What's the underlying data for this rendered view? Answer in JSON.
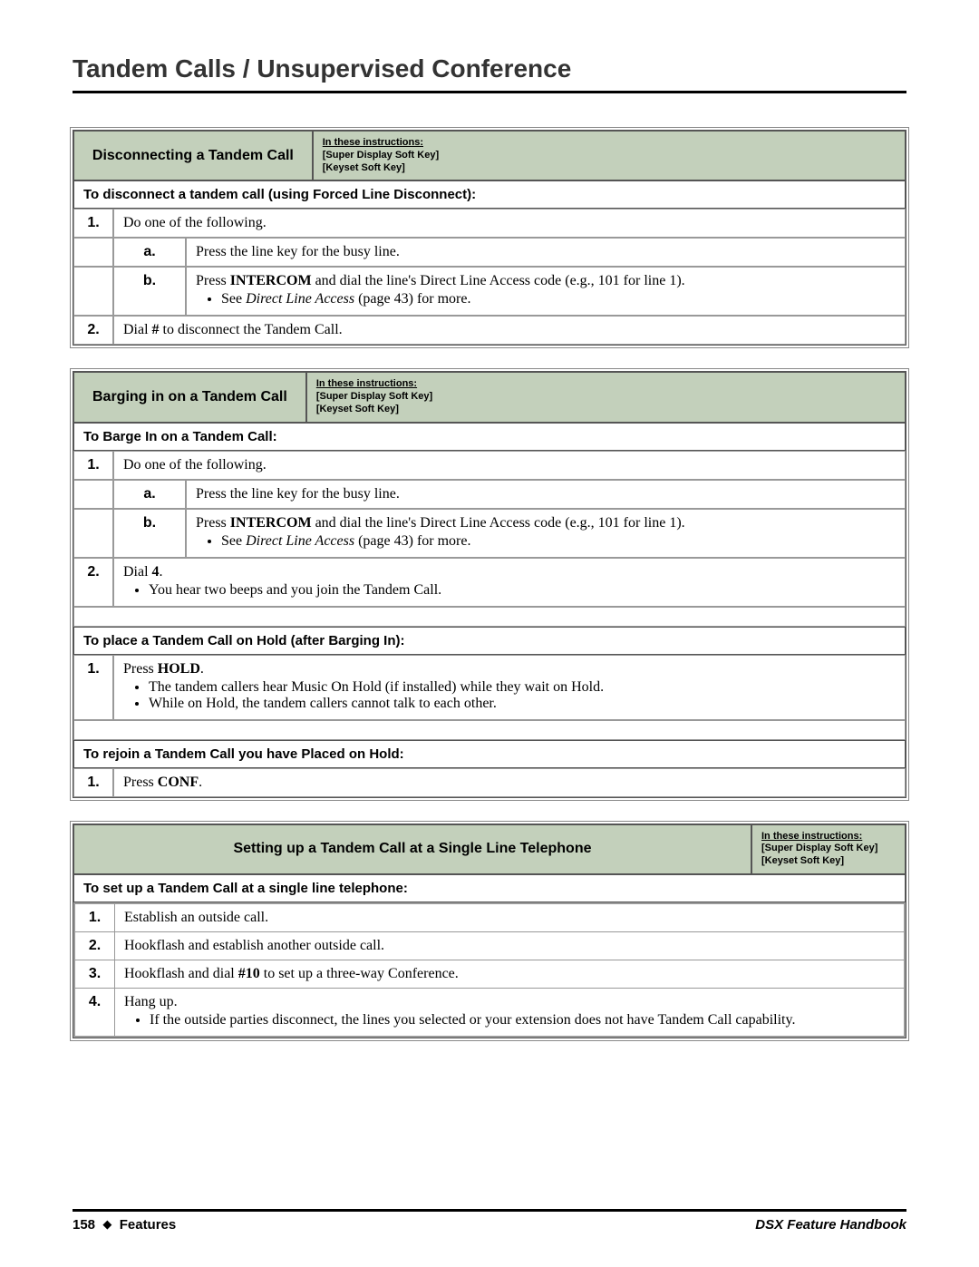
{
  "title": "Tandem Calls / Unsupervised Conference",
  "note": {
    "line1": "In these instructions:",
    "line2": "[Super Display Soft Key]",
    "line3": "[Keyset Soft Key]"
  },
  "table1": {
    "header": "Disconnecting a Tandem Call",
    "section1": "To disconnect a tandem call (using Forced Line Disconnect):",
    "step1_num": "1.",
    "step1": "Do one of the following.",
    "sub_a": "a.",
    "sub_a_text": "Press the line key for the busy line.",
    "sub_b": "b.",
    "sub_b_prefix": "Press ",
    "sub_b_bold": "INTERCOM",
    "sub_b_suffix": " and dial the line's Direct Line Access code (e.g., 101 for line 1).",
    "sub_b_bullet_pre": "See ",
    "sub_b_bullet_it": "Direct Line Access",
    "sub_b_bullet_post": " (page 43) for more.",
    "step2_num": "2.",
    "step2_pre": "Dial ",
    "step2_bold": "#",
    "step2_post": " to disconnect the Tandem Call."
  },
  "table2": {
    "header": "Barging in on a Tandem Call",
    "section1": "To Barge In on a Tandem Call:",
    "step1_num": "1.",
    "step1": "Do one of the following.",
    "sub_a": "a.",
    "sub_a_text": "Press the line key for the busy line.",
    "sub_b": "b.",
    "sub_b_prefix": "Press ",
    "sub_b_bold": "INTERCOM",
    "sub_b_suffix": " and dial the line's Direct Line Access code (e.g., 101 for line 1).",
    "sub_b_bullet_pre": "See ",
    "sub_b_bullet_it": "Direct Line Access",
    "sub_b_bullet_post": " (page 43) for more.",
    "step2_num": "2.",
    "step2_pre": "Dial ",
    "step2_bold": "4",
    "step2_post": ".",
    "step2_bullet": "You hear two beeps and you join the Tandem Call.",
    "section2": "To place a Tandem Call on Hold (after Barging In):",
    "s2_step1_num": "1.",
    "s2_step1_pre": "Press ",
    "s2_step1_bold": "HOLD",
    "s2_step1_post": ".",
    "s2_step1_b1": "The tandem callers hear Music On Hold (if installed) while they wait on Hold.",
    "s2_step1_b2": "While on Hold, the tandem callers cannot talk to each other.",
    "section3": "To rejoin a Tandem Call you have Placed on Hold:",
    "s3_step1_num": "1.",
    "s3_step1_pre": "Press ",
    "s3_step1_bold": "CONF",
    "s3_step1_post": "."
  },
  "table3": {
    "header": "Setting up a Tandem Call at a Single Line Telephone",
    "section1": "To set up a Tandem Call at a single line telephone:",
    "step1_num": "1.",
    "step1": "Establish an outside call.",
    "step2_num": "2.",
    "step2": "Hookflash and establish another outside call.",
    "step3_num": "3.",
    "step3_pre": "Hookflash and dial ",
    "step3_bold": "#10",
    "step3_post": " to set up a three-way Conference.",
    "step4_num": "4.",
    "step4": "Hang up.",
    "step4_bullet": "If the outside parties disconnect, the lines you selected or your extension does not have Tandem Call capability."
  },
  "footer": {
    "page": "158",
    "diamond": "◆",
    "section": "Features",
    "book": "DSX Feature Handbook"
  }
}
